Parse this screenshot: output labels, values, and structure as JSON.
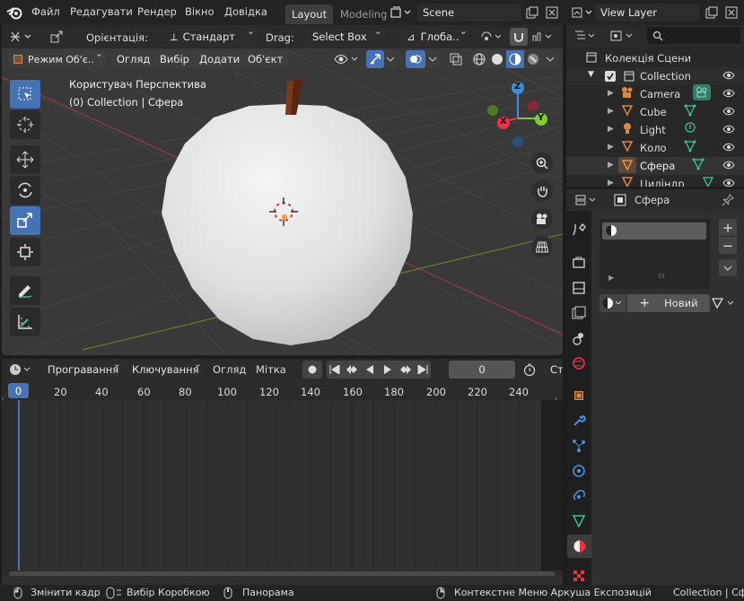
{
  "topbar": {
    "menu": [
      "Файл",
      "Редагувати",
      "Рендер",
      "Вікно",
      "Довідка"
    ],
    "workspace_tabs": [
      "Layout",
      "Modeling"
    ],
    "scene_name": "Scene",
    "view_layer": "View Layer"
  },
  "viewport_header": {
    "orientation_label": "Орієнтація:",
    "orientation_value": "Стандарт",
    "drag_label": "Drag:",
    "drag_value": "Select Box",
    "transform_value": "Глоба..",
    "mode": "Режим Об'є..",
    "menus": [
      "Огляд",
      "Вибір",
      "Додати",
      "Об'єкт"
    ]
  },
  "viewport": {
    "view_name": "Користувач Перспектива",
    "context": "(0) Collection | Сфера",
    "gizmo_axes": [
      "Z",
      "Y",
      "X"
    ]
  },
  "outliner": {
    "search_placeholder": "",
    "root": "Колекція Сцени",
    "collection": "Collection",
    "items": [
      {
        "name": "Camera",
        "type": "camera"
      },
      {
        "name": "Cube",
        "type": "mesh"
      },
      {
        "name": "Light",
        "type": "light"
      },
      {
        "name": "Коло",
        "type": "mesh"
      },
      {
        "name": "Сфера",
        "type": "mesh",
        "active": true
      },
      {
        "name": "Циліндр",
        "type": "mesh"
      }
    ]
  },
  "properties": {
    "object_name": "Сфера",
    "new_button": "Новий"
  },
  "timeline": {
    "menus": [
      "Програвання",
      "Ключування",
      "Огляд",
      "Мітка"
    ],
    "current_frame": "0",
    "start_label": "Ст",
    "ruler_current": "0",
    "ruler_ticks": [
      "20",
      "40",
      "60",
      "80",
      "100",
      "120",
      "140",
      "160",
      "180",
      "200",
      "220",
      "240"
    ]
  },
  "statusbar": {
    "hints": [
      "Змінити кадр",
      "Вибір Коробкою",
      "Панорама",
      "Контекстне Меню Аркуша Експозицій"
    ],
    "right": "Collection | Сфе"
  },
  "colors": {
    "accent": "#4772b3",
    "mesh_icon": "#3fc1a0",
    "object_icon": "#e0883c",
    "axis_x": "#e8334a",
    "axis_y": "#7fcb33",
    "axis_z": "#3a8fe0"
  }
}
